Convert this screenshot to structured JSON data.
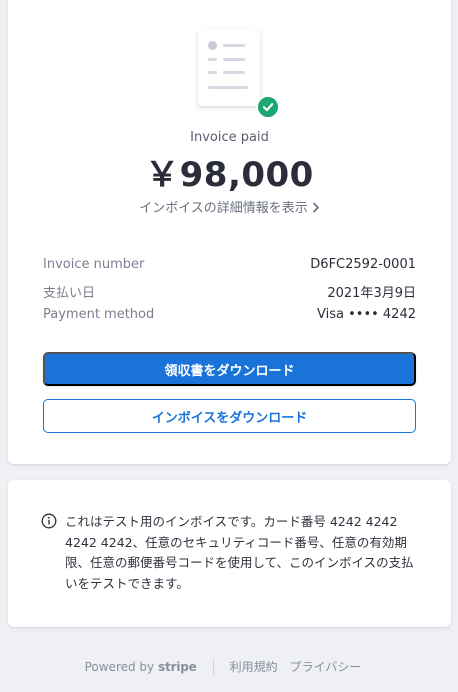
{
  "invoice": {
    "status": "Invoice paid",
    "amount": "￥98,000",
    "details_link": "インボイスの詳細情報を表示"
  },
  "meta": [
    {
      "label": "Invoice number",
      "value": "D6FC2592-0001"
    },
    {
      "label": "支払い日",
      "value": "2021年3月9日"
    },
    {
      "label": "Payment method",
      "value": "Visa •••• 4242"
    }
  ],
  "actions": {
    "download_receipt": "領収書をダウンロード",
    "download_invoice": "インボイスをダウンロード"
  },
  "notice": {
    "text": "これはテスト用のインボイスです。カード番号 4242 4242 4242 4242、任意のセキュリティコード番号、任意の有効期限、任意の郵便番号コードを使用して、このインボイスの支払いをテストできます。"
  },
  "footer": {
    "powered_by": "Powered by",
    "brand": "stripe",
    "terms": "利用規約",
    "privacy": "プライバシー"
  },
  "colors": {
    "accent": "#1a73d9",
    "success": "#1ea672",
    "background": "#eef0f4"
  },
  "icons": {
    "document": "document-icon",
    "check": "check-circle-icon",
    "chevron": "chevron-right-icon",
    "info": "info-circle-icon"
  }
}
